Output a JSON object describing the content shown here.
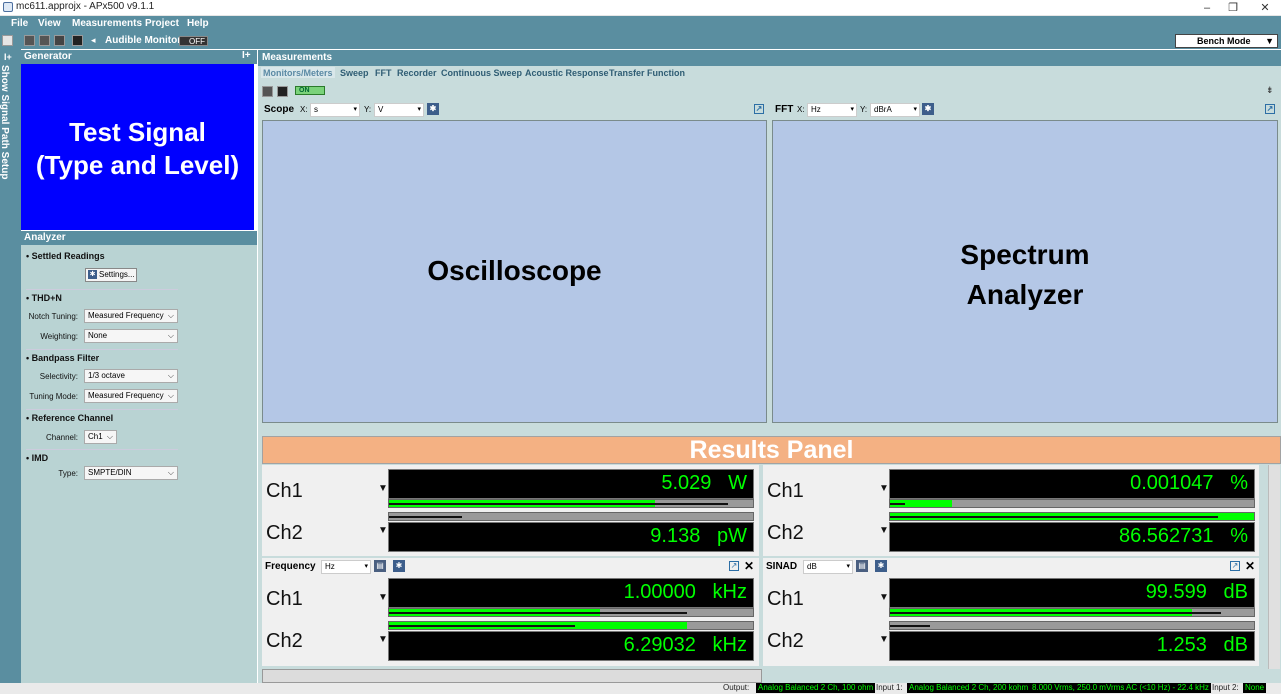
{
  "window": {
    "title": "mc611.approjx - APx500 v9.1.1",
    "minimize": "–",
    "restore": "❐",
    "close": "✕"
  },
  "menu": [
    "File",
    "View",
    "Measurements",
    "Project",
    "Help"
  ],
  "toolbar": {
    "audible_label": "Audible Monitor",
    "audible_state": "OFF",
    "bench_mode": "Bench Mode",
    "dropdown": "▼"
  },
  "left_tab": {
    "label": "Show Signal Path Setup",
    "pin": "I+"
  },
  "generator": {
    "header": "Generator",
    "pin": "I+",
    "line1": "Test Signal",
    "line2": "(Type and Level)",
    "color": "#0000ff"
  },
  "analyzer": {
    "header": "Analyzer",
    "settled_readings": "• Settled Readings",
    "settings_button": "Settings...",
    "thdn": "• THD+N",
    "notch_label": "Notch Tuning:",
    "notch_value": "Measured Frequency",
    "weighting_label": "Weighting:",
    "weighting_value": "None",
    "bandpass": "• Bandpass Filter",
    "selectivity_label": "Selectivity:",
    "selectivity_value": "1/3 octave",
    "tuning_label": "Tuning Mode:",
    "tuning_value": "Measured Frequency",
    "refch": "• Reference Channel",
    "channel_label": "Channel:",
    "channel_value": "Ch1",
    "imd": "• IMD",
    "type_label": "Type:",
    "type_value": "SMPTE/DIN",
    "chev": "⌵"
  },
  "measurements": {
    "header": "Measurements",
    "tabs": [
      "Monitors/Meters",
      "Sweep",
      "FFT",
      "Recorder",
      "Continuous Sweep",
      "Acoustic Response",
      "Transfer Function"
    ],
    "on_label": "ON"
  },
  "scope": {
    "title": "Scope",
    "x_label": "X:",
    "x_value": "s",
    "y_label": "Y:",
    "y_value": "V",
    "plot_label": "Oscilloscope"
  },
  "fft": {
    "title": "FFT",
    "x_label": "X:",
    "x_value": "Hz",
    "y_label": "Y:",
    "y_value": "dBrA",
    "plot_line1": "Spectrum",
    "plot_line2": "Analyzer"
  },
  "results_banner": "Results Panel",
  "meters": {
    "power": {
      "ch1_label": "Ch1",
      "ch1_value": "5.029",
      "ch1_unit": "W",
      "ch1_bar": 0.73,
      "ch1_peak": 0.93,
      "ch2_label": "Ch2",
      "ch2_value": "9.138",
      "ch2_unit": "pW",
      "ch2_bar": 0.0,
      "ch2_peak": 0.2
    },
    "thdn": {
      "ch1_label": "Ch1",
      "ch1_value": "0.001047",
      "ch1_unit": "%",
      "ch1_bar": 0.17,
      "ch1_peak": 0.04,
      "ch2_label": "Ch2",
      "ch2_value": "86.562731",
      "ch2_unit": "%",
      "ch2_bar": 1.0,
      "ch2_peak": 0.9
    },
    "frequency": {
      "title": "Frequency",
      "unit_sel": "Hz",
      "ch1_label": "Ch1",
      "ch1_value": "1.00000",
      "ch1_unit": "kHz",
      "ch1_bar": 0.58,
      "ch1_peak": 0.82,
      "ch2_label": "Ch2",
      "ch2_value": "6.29032",
      "ch2_unit": "kHz",
      "ch2_bar": 0.82,
      "ch2_peak": 0.51
    },
    "sinad": {
      "title": "SINAD",
      "unit_sel": "dB",
      "ch1_label": "Ch1",
      "ch1_value": "99.599",
      "ch1_unit": "dB",
      "ch1_bar": 0.83,
      "ch1_peak": 0.91,
      "ch2_label": "Ch2",
      "ch2_value": "1.253",
      "ch2_unit": "dB",
      "ch2_bar": 0.0,
      "ch2_peak": 0.11
    }
  },
  "status": {
    "output_label": "Output:",
    "output_value": "Analog Balanced 2 Ch, 100 ohm",
    "input1_label": "Input 1:",
    "input1_value": "Analog Balanced 2 Ch, 200 kohm",
    "input1_level": "8.000 Vrms, 250.0 mVrms",
    "input1_filter": "AC (<10 Hz) - 22.4 kHz",
    "input2_label": "Input 2:",
    "input2_value": "None"
  }
}
